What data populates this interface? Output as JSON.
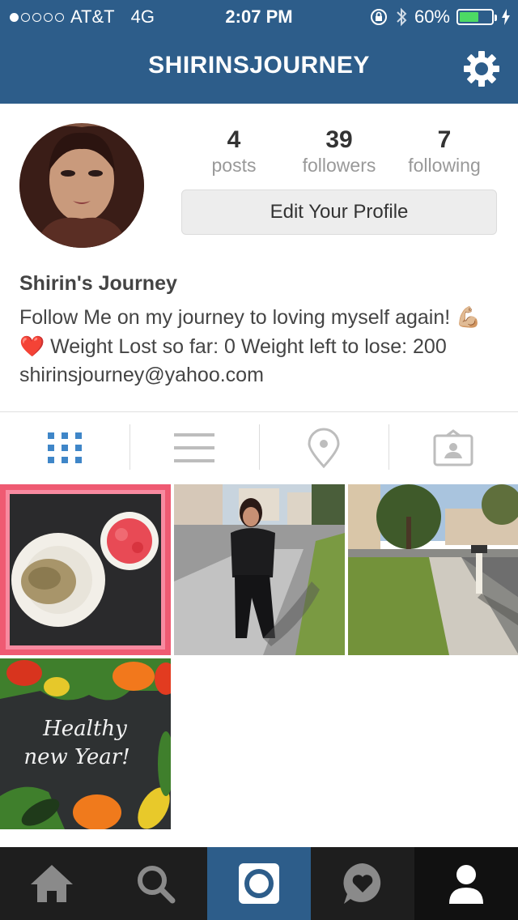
{
  "status_bar": {
    "carrier": "AT&T",
    "network": "4G",
    "time": "2:07 PM",
    "battery_percent": "60%",
    "battery_level": 0.6,
    "signal_dots_filled": 1,
    "signal_dots_total": 5
  },
  "header": {
    "title": "SHIRINSJOURNEY",
    "settings_icon": "gear-icon",
    "background_color": "#2d5d8a"
  },
  "profile": {
    "posts": {
      "count": "4",
      "label": "posts"
    },
    "followers": {
      "count": "39",
      "label": "followers"
    },
    "following": {
      "count": "7",
      "label": "following"
    },
    "edit_button_label": "Edit Your Profile",
    "display_name": "Shirin's Journey",
    "bio_part1": "Follow Me on my journey to loving myself again!",
    "bio_emoji1": "💪🏼",
    "bio_emoji2": "❤️",
    "bio_part2": "Weight Lost so far: 0 Weight left to lose: 200 shirinsjourney@yahoo.com"
  },
  "view_tabs": [
    {
      "icon": "grid-icon",
      "active": true
    },
    {
      "icon": "list-icon",
      "active": false
    },
    {
      "icon": "location-pin-icon",
      "active": false
    },
    {
      "icon": "tagged-photos-icon",
      "active": false
    }
  ],
  "posts_grid": [
    {
      "name": "post-healthy-meal"
    },
    {
      "name": "post-woman-on-sidewalk"
    },
    {
      "name": "post-street-view"
    },
    {
      "name": "post-healthy-new-year",
      "caption_line1": "Healthy",
      "caption_line2": "new Year!"
    }
  ],
  "bottom_nav": [
    {
      "icon": "home-icon"
    },
    {
      "icon": "search-icon"
    },
    {
      "icon": "camera-icon"
    },
    {
      "icon": "activity-heart-icon"
    },
    {
      "icon": "profile-icon",
      "active": true
    }
  ],
  "colors": {
    "accent": "#2d5d8a",
    "active_tab": "#3f86c8",
    "inactive_icon": "#bdbdbd"
  }
}
